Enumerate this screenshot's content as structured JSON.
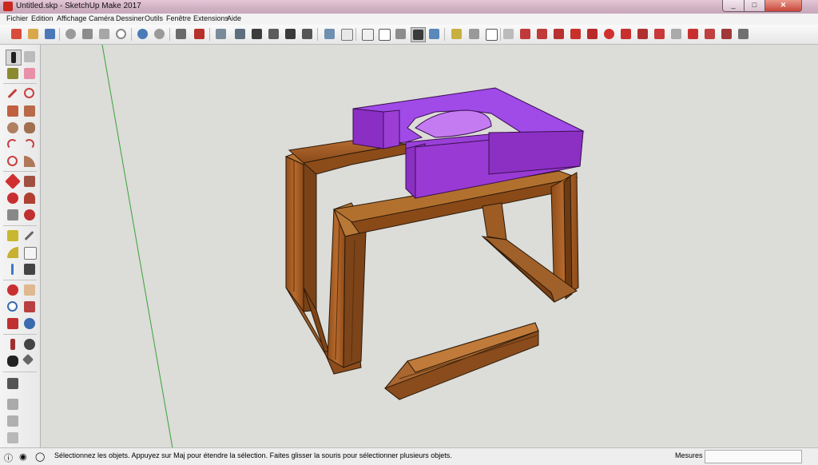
{
  "window": {
    "title": "Untitled.skp - SketchUp Make 2017"
  },
  "menu": [
    "Fichier",
    "Edition",
    "Affichage",
    "Caméra",
    "Dessiner",
    "Outils",
    "Fenêtre",
    "Extensions",
    "Aide"
  ],
  "toolbar": {
    "icons": [
      "new-model-icon",
      "open-icon",
      "save-icon",
      "cut-icon",
      "copy-icon",
      "paste-icon",
      "erase-icon",
      "undo-icon",
      "redo-icon",
      "print-icon",
      "model-info-icon",
      "iso-view-icon",
      "top-view-icon",
      "front-view-icon",
      "right-view-icon",
      "back-view-icon",
      "left-view-icon",
      "xray-icon",
      "back-edges-icon",
      "wireframe-icon",
      "hidden-line-icon",
      "shaded-icon",
      "shaded-textures-icon",
      "monochrome-icon",
      "warehouse-icon",
      "extension-icon",
      "layers-icon",
      "sandbox-icon"
    ]
  },
  "leftbar": {
    "tools": [
      "select-tool-icon",
      "component-tool-icon",
      "paint-bucket-icon",
      "eraser-icon",
      "line-tool-icon",
      "freehand-icon",
      "rectangle-icon",
      "rotated-rectangle-icon",
      "circle-icon",
      "polygon-icon",
      "arc-icon",
      "arc-2pt-icon",
      "pie-icon",
      "three-point-arc-icon",
      "move-icon",
      "push-pull-icon",
      "rotate-icon",
      "follow-me-icon",
      "scale-icon",
      "offset-icon",
      "tape-measure-icon",
      "dimension-icon",
      "protractor-icon",
      "text-icon",
      "axes-icon",
      "3d-text-icon",
      "orbit-icon",
      "pan-icon",
      "zoom-icon",
      "zoom-window-icon",
      "zoom-extents-icon",
      "previous-view-icon",
      "position-camera-icon",
      "look-around-icon",
      "walk-icon",
      "section-plane-icon",
      "sandbox-from-contours-icon",
      "sandbox-from-scratch-icon",
      "smoove-icon"
    ]
  },
  "status": {
    "message": "Sélectionnez les objets. Appuyez sur Maj pour étendre la sélection. Faites glisser la souris pour sélectionner plusieurs objets.",
    "measure_label": "Mesures",
    "measure_value": ""
  },
  "colors": {
    "cushion": "#9f3ee6",
    "wood": "#a05a22",
    "canvas": "#dcdcd8"
  }
}
